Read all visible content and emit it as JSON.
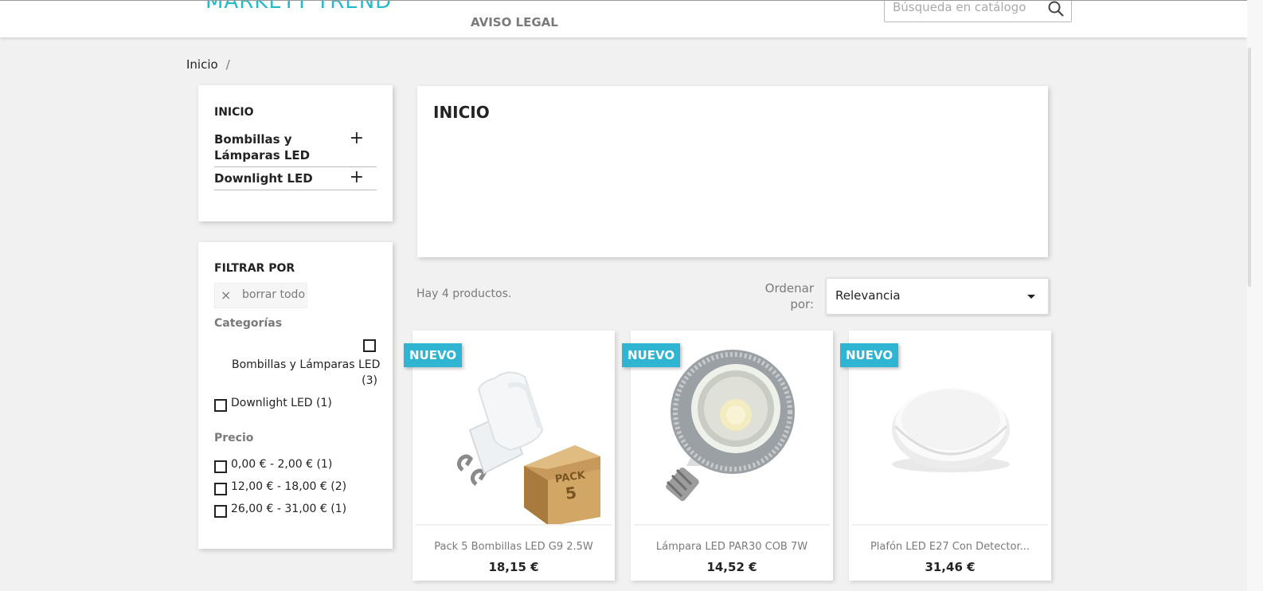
{
  "header": {
    "logo": "MARKETT TREND",
    "nav_link": "AVISO LEGAL",
    "search_placeholder": "Búsqueda en catálogo",
    "search_icon": "search-icon"
  },
  "breadcrumb": {
    "home": "Inicio",
    "separator": "/"
  },
  "categories": {
    "title": "INICIO",
    "items": [
      {
        "label": "Bombillas y Lámparas LED",
        "expand": "+"
      },
      {
        "label": "Downlight LED",
        "expand": "+"
      }
    ]
  },
  "filters": {
    "title": "FILTRAR POR",
    "clear_icon": "×",
    "clear_label": "borrar todo",
    "category_title": "Categorías",
    "category_options": [
      {
        "label": "Bombillas y Lámparas LED",
        "count": "(3)"
      },
      {
        "label": "Downlight LED (1)"
      }
    ],
    "price_title": "Precio",
    "price_options": [
      {
        "label": "0,00 € - 2,00 € (1)"
      },
      {
        "label": "12,00 € - 18,00 € (2)"
      },
      {
        "label": "26,00 € - 31,00 € (1)"
      }
    ]
  },
  "main": {
    "title": "INICIO",
    "count_text": "Hay 4 productos.",
    "sort_label": "Ordenar por:",
    "sort_value": "Relevancia"
  },
  "products": [
    {
      "badge": "NUEVO",
      "name": "Pack 5 Bombillas LED G9 2.5W",
      "price": "18,15 €",
      "pack_label": "PACK",
      "pack_num": "5"
    },
    {
      "badge": "NUEVO",
      "name": "Lámpara LED PAR30 COB 7W",
      "price": "14,52 €"
    },
    {
      "badge": "NUEVO",
      "name": "Plafón LED E27 Con Detector...",
      "price": "31,46 €"
    }
  ],
  "colors": {
    "accent": "#2fb5d2",
    "logo": "#22bbc9",
    "background": "#f1f1f1"
  }
}
